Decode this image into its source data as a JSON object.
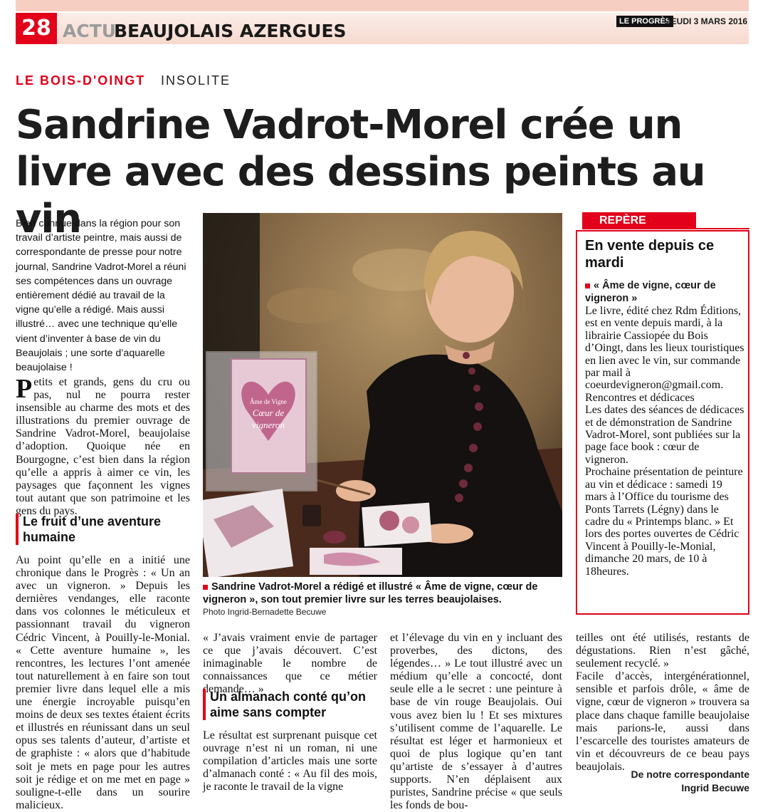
{
  "header": {
    "page_number": "28",
    "section_prefix": "ACTU",
    "section_name": "BEAUJOLAIS AZERGUES",
    "newspaper": "LE PROGRÈS",
    "date": "JEUDI 3 MARS 2016"
  },
  "article": {
    "location": "LE BOIS-D'OINGT",
    "kicker": "INSOLITE",
    "headline": "Sandrine Vadrot-Morel crée un livre avec des dessins peints au vin",
    "lead": "Bien connue dans la région pour son travail d’artiste peintre, mais aussi de correspondante de presse pour notre journal, Sandrine Vadrot-Morel a réuni ses compétences dans un ouvrage entièrement dédié au travail de la vigne qu’elle a rédigé. Mais aussi illustré… avec une technique qu’elle vient d’inventer à base de vin du Beaujolais ; une sorte d’aquarelle beaujolaise !",
    "dropcap": "P",
    "para1": "etits et grands, gens du cru ou pas, nul ne pourra rester insensible au charme des mots et des illustrations du premier ouvrage de Sandrine Vadrot-Morel, beaujolaise d’adoption. Quoique née en Bourgogne, c’est bien dans la région qu’elle a appris à aimer ce vin, les paysages que façonnent les vignes tout autant que son patrimoine et les gens du pays.",
    "subhead1": "Le fruit d’une aventure humaine",
    "para2": "Au point qu’elle en a initié une chronique dans le Progrès : « Un an avec un vigneron. » Depuis les dernières vendanges, elle raconte dans vos colonnes le méticuleux et passionnant travail du vigneron Cédric Vincent, à Pouilly-le-Monial. « Cette aventure humaine », les rencontres, les lectures l’ont amenée tout naturellement à en faire son tout premier livre dans lequel elle a mis une énergie incroyable puisqu’en moins de deux ses textes étaient écrits et illustrés en réunissant dans un seul opus ses talents d’auteur, d’artiste et de graphiste : « alors que d’habitude soit je mets en page pour les autres soit je rédige et on me met en page » souligne-t-elle dans un sourire malicieux.",
    "para3": "« J’avais vraiment envie de partager ce que j’avais découvert. C’est inimaginable le nombre de connaissances que ce métier demande… »",
    "subhead2": "Un almanach conté qu’on aime sans compter",
    "para4": "Le résultat est surprenant puisque cet ouvrage n’est ni un roman, ni une compilation d’articles mais une sorte d’almanach conté : « Au fil des mois, je raconte le travail de la vigne",
    "para5": "et l’élevage du vin en y incluant des proverbes, des dictons, des légendes… » Le tout illustré avec un médium qu’elle a concocté, dont seule elle a le secret : une peinture à base de vin rouge Beaujolais. Oui vous avez bien lu ! Et ses mixtures s’utilisent comme de l’aquarelle. Le résultat est léger et harmonieux et quoi de plus logique qu’en tant qu’artiste de s’essayer à d’autres supports. N’en déplaisent aux puristes, Sandrine précise « que seuls les fonds de bou-",
    "para6": "teilles ont été utilisés, restants de dégustations. Rien n’est gâché, seulement recyclé. »",
    "para7": "Facile d’accès, intergénérationnel, sensible et parfois drôle, « âme de vigne, cœur de vigneron » trouvera sa place dans chaque famille beaujolaise mais parions-le, aussi dans l’escarcelle des touristes amateurs de vin et découvreurs de ce beau pays beaujolais.",
    "signature_1": "De notre correspondante",
    "signature_2": "Ingrid Becuwe"
  },
  "photo": {
    "caption": "Sandrine Vadrot-Morel a rédigé et illustré « Âme de vigne, cœur de vigneron », son tout premier livre sur les terres beaujolaises.",
    "credit": "Photo Ingrid-Bernadette Becuwe",
    "book_label_1": "Âme de Vigne",
    "book_label_2": "Cœur de",
    "book_label_3": "vigneron"
  },
  "sidebar": {
    "tag": "REPÈRE",
    "title": "En vente depuis ce mardi",
    "subtitle": "« Âme de vigne, cœur de vigneron »",
    "text": "Le livre, édité chez Rdm Éditions, est en vente depuis mardi, à la librairie Cassiopée du Bois d’Oingt, dans les lieux touristiques en lien avec le vin, sur commande par mail à coeurdevigneron@gmail.com.",
    "text2": "Rencontres et dédicaces",
    "text3": "Les dates des séances de dédicaces et de démonstration de Sandrine Vadrot-Morel, sont publiées sur la page face book : cœur de vigneron.",
    "text4": "Prochaine présentation de peinture au vin et dédicace : samedi 19 mars à l’Office du tourisme des Ponts Tarrets (Légny) dans le cadre du « Printemps blanc. » Et lors des portes ouvertes de Cédric Vincent à Pouilly-le-Monial, dimanche 20 mars, de 10 à 18heures."
  },
  "colors": {
    "accent": "#e2001a",
    "header_tint": "#f7cfc2"
  }
}
